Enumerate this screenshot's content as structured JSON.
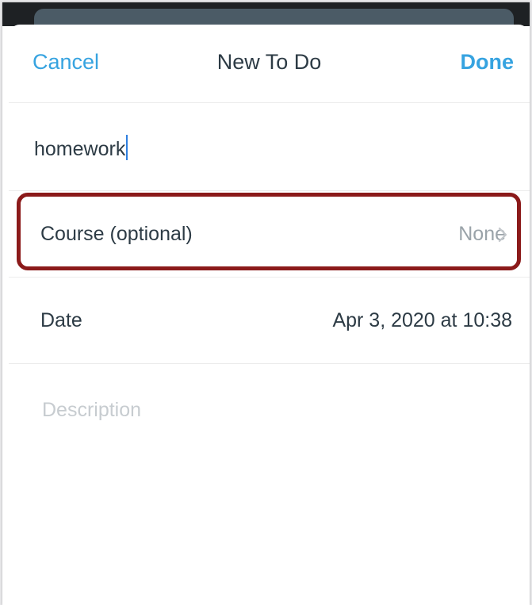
{
  "navbar": {
    "cancel_label": "Cancel",
    "title": "New To Do",
    "done_label": "Done"
  },
  "todo": {
    "title_value": "homework",
    "course": {
      "label": "Course (optional)",
      "value": "None",
      "icon": "chevron-right-icon"
    },
    "date": {
      "label": "Date",
      "value": "Apr 3, 2020 at 10:38"
    },
    "description_placeholder": "Description"
  },
  "colors": {
    "accent": "#36a3e0",
    "text": "#2d3b45",
    "muted": "#9aa3a9",
    "placeholder": "#c7ccd0",
    "highlight_border": "#8b1a1a",
    "caret": "#2f7fe0"
  }
}
